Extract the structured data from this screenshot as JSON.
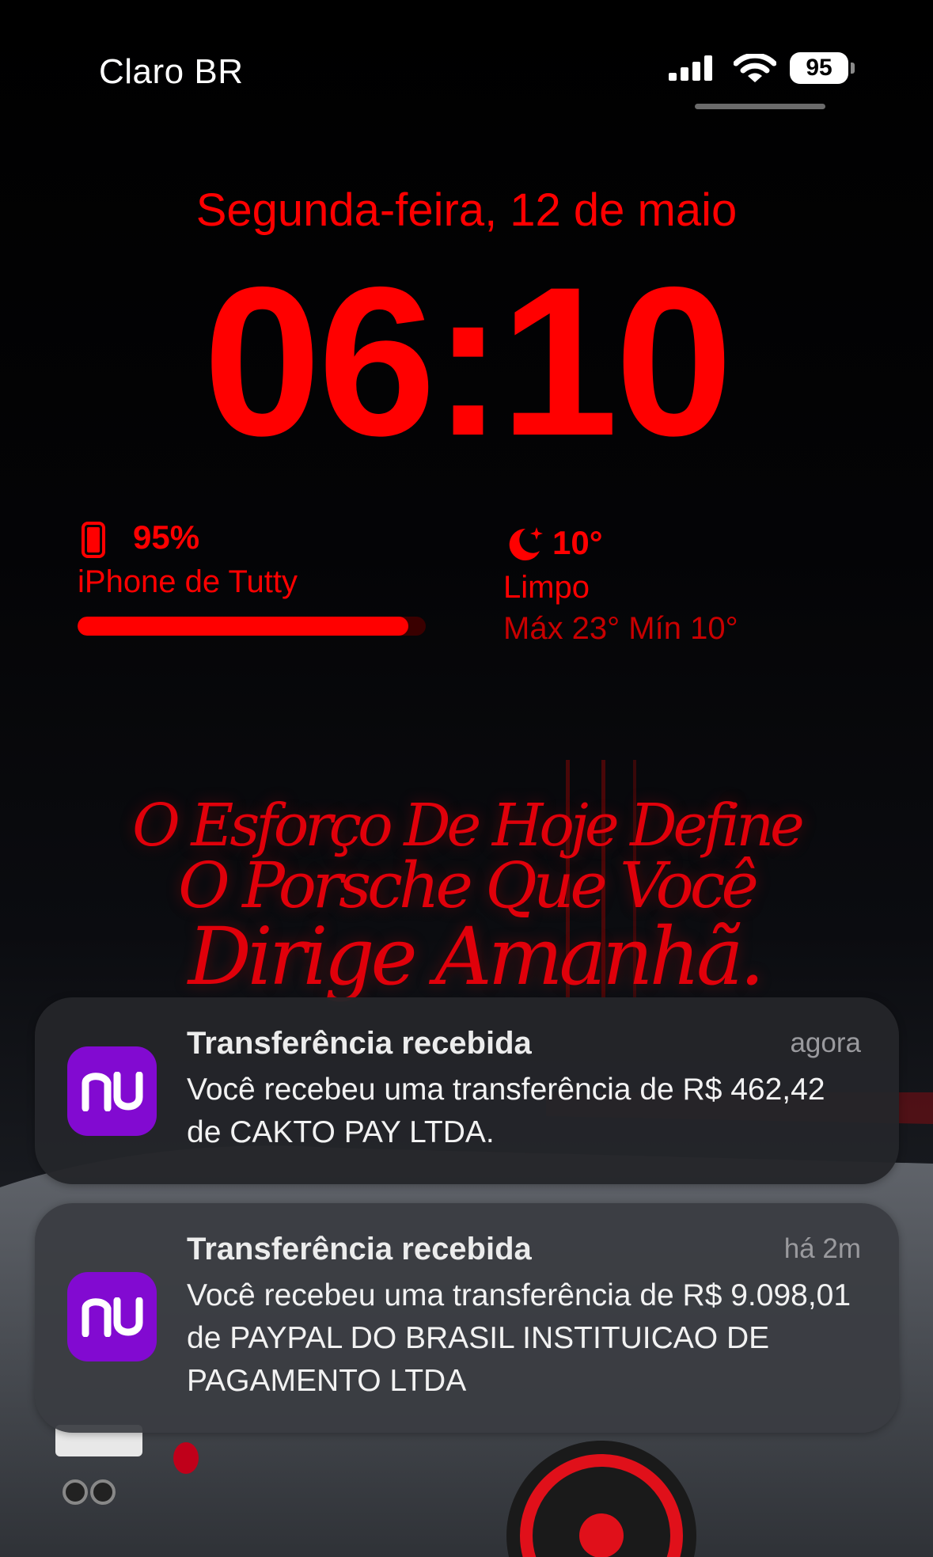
{
  "status_bar": {
    "carrier": "Claro BR",
    "battery_level": "95",
    "icons": [
      "signal-bars-icon",
      "wifi-icon",
      "battery-icon"
    ]
  },
  "lock_screen": {
    "date": "Segunda-feira, 12 de maio",
    "time": "06:10",
    "accent_color": "#ff0000"
  },
  "widgets": {
    "battery": {
      "percent_label": "95%",
      "device": "iPhone de Tutty",
      "level_fraction": 0.95,
      "icon": "iphone-icon"
    },
    "weather": {
      "temperature": "10°",
      "condition": "Limpo",
      "high_low": "Máx 23° Mín 10°",
      "icon": "moon-stars-icon"
    }
  },
  "wallpaper": {
    "quote_lines": [
      "O Esforço De Hoje Define",
      "O Porsche Que Você",
      "Dirige Amanhã."
    ]
  },
  "notifications": [
    {
      "app": "Nubank",
      "app_icon_text": "nu",
      "app_color": "#820ad1",
      "title": "Transferência recebida",
      "time": "agora",
      "body": "Você recebeu uma transferência de R$ 462,42 de CAKTO PAY LTDA."
    },
    {
      "app": "Nubank",
      "app_icon_text": "nu",
      "app_color": "#820ad1",
      "title": "Transferência recebida",
      "time": "há 2m",
      "body": "Você recebeu uma transferência de R$ 9.098,01 de PAYPAL DO BRASIL INSTITUICAO DE PAGAMENTO LTDA"
    }
  ]
}
